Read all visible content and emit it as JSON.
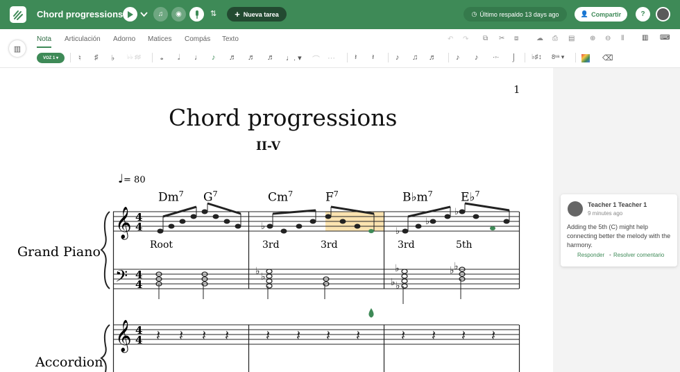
{
  "header": {
    "title": "Chord progressions",
    "new_task_label": "Nueva tarea",
    "backup_text": "Último respaldo 13 days ago",
    "share_label": "Compartir"
  },
  "tabs": [
    "Nota",
    "Articulación",
    "Adorno",
    "Matices",
    "Compás",
    "Texto"
  ],
  "toolbar": {
    "voice_label": "VOZ 1"
  },
  "score": {
    "page_number": "1",
    "title": "Chord progressions",
    "subtitle": "II-V",
    "tempo": "= 80",
    "chords": [
      {
        "root": "D",
        "quality": "m",
        "ext": "7"
      },
      {
        "root": "G",
        "quality": "",
        "ext": "7"
      },
      {
        "root": "C",
        "quality": "m",
        "ext": "7"
      },
      {
        "root": "F",
        "quality": "",
        "ext": "7"
      },
      {
        "root": "B♭",
        "quality": "m",
        "ext": "7"
      },
      {
        "root": "E♭",
        "quality": "",
        "ext": "7"
      }
    ],
    "lyrics": [
      "Root",
      "3rd",
      "3rd",
      "3rd",
      "5th"
    ],
    "instruments": [
      "Grand Piano",
      "Accordion"
    ]
  },
  "comment": {
    "author": "Teacher 1 Teacher 1",
    "time": "9 minutes ago",
    "text": "Adding the 5th (C) might help connecting better the melody with the harmony.",
    "reply_label": "Responder",
    "resolve_label": "Resolver comentario"
  },
  "colors": {
    "brand": "#3e8a57",
    "highlight": "#fbe3b0"
  }
}
